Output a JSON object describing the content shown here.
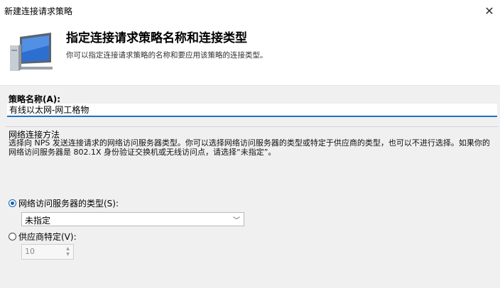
{
  "window": {
    "title": "新建连接请求策略",
    "close_glyph": "✕"
  },
  "header": {
    "title": "指定连接请求策略名称和连接类型",
    "subtitle": "你可以指定连接请求策略的名称和要应用该策略的连接类型。",
    "icon": "monitor-icon"
  },
  "policy_name": {
    "label": "策略名称(A):",
    "value": "有线以太网-网工格物"
  },
  "connection_method": {
    "group_title": "网络连接方法",
    "description": "选择向 NPS 发送连接请求的网络访问服务器类型。你可以选择网络访问服务器的类型或特定于供应商的类型，也可以不进行选择。如果你的网络访问服务器是 802.1X 身份验证交换机或无线访问点，请选择“未指定”。",
    "option_type": {
      "label": "网络访问服务器的类型(S):",
      "checked": true,
      "selected_value": "未指定"
    },
    "option_vendor": {
      "label": "供应商特定(V):",
      "checked": false,
      "spinner_value": "10"
    }
  },
  "colors": {
    "accent": "#1a73c4",
    "radio_checked": "#1a5fb4"
  }
}
